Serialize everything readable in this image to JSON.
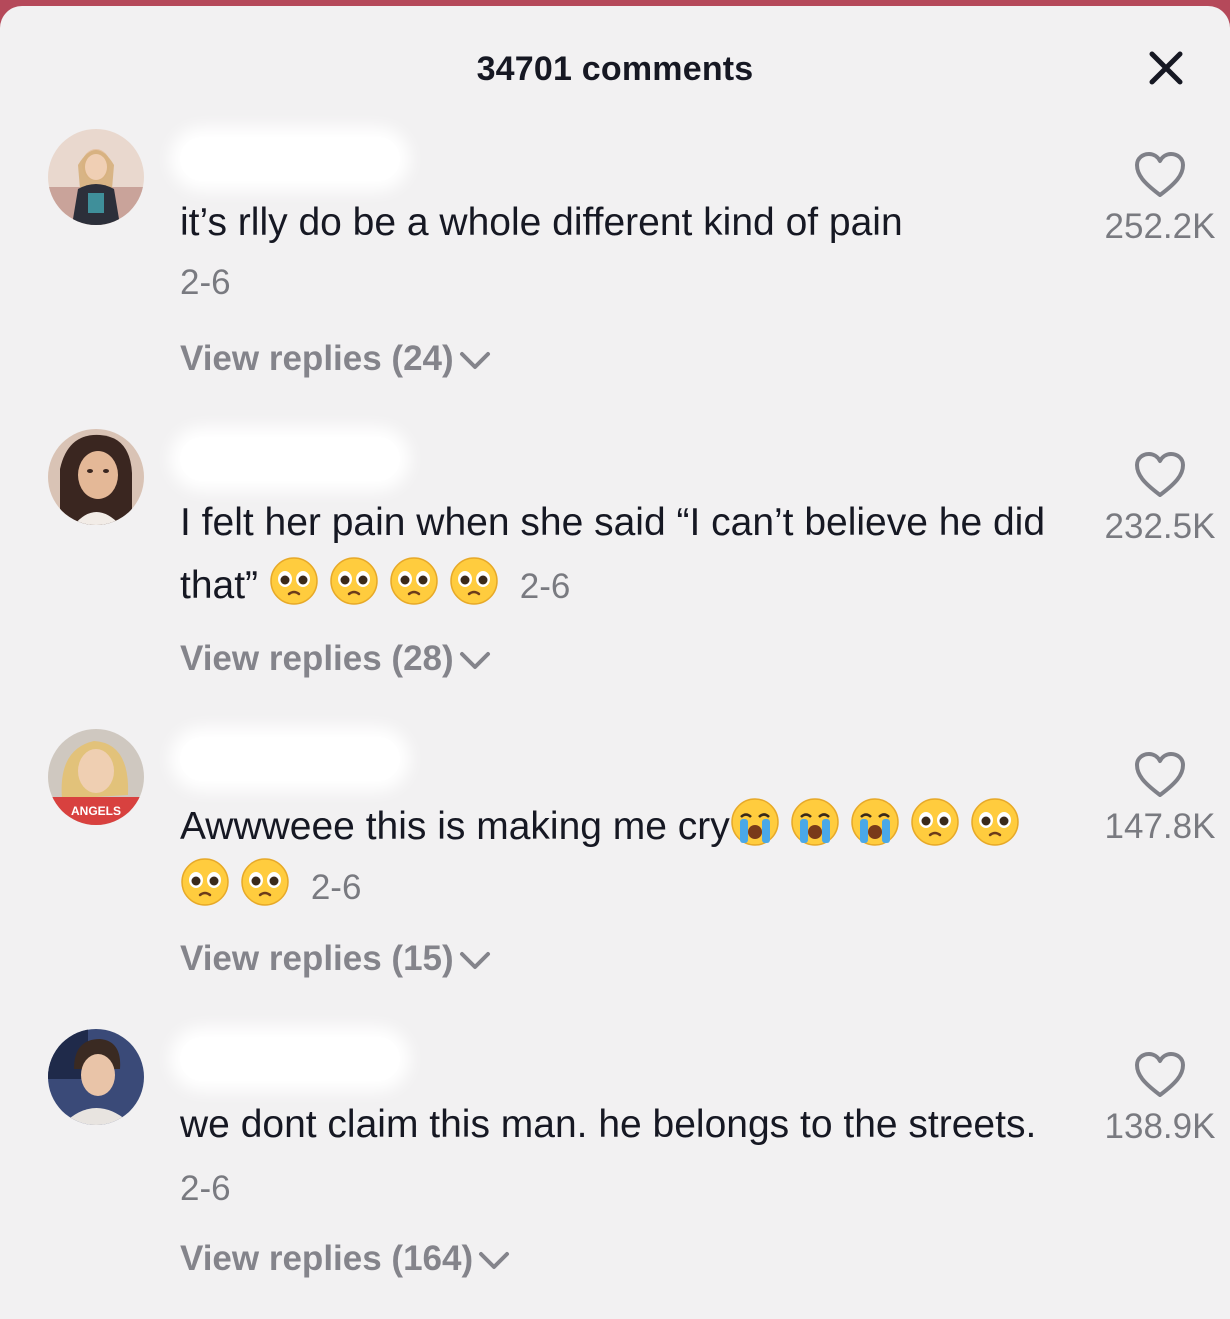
{
  "header": {
    "title": "34701 comments",
    "close_icon": "close-icon"
  },
  "comments": [
    {
      "text": "it’s rlly do be a whole different kind of pain",
      "emojis": [],
      "date": "2-6",
      "replies": "View replies (24)",
      "likes": "252.2K"
    },
    {
      "text": "I felt her pain when she said “I can’t believe he did that”",
      "emojis": [
        "pleading-face",
        "pleading-face",
        "pleading-face",
        "pleading-face"
      ],
      "date": "2-6",
      "replies": "View replies (28)",
      "likes": "232.5K"
    },
    {
      "text": "Awwweee this is making me cry",
      "emojis": [
        "loudly-crying-face",
        "loudly-crying-face",
        "loudly-crying-face",
        "pleading-face",
        "pleading-face",
        "pleading-face",
        "pleading-face"
      ],
      "date": "2-6",
      "replies": "View replies (15)",
      "likes": "147.8K"
    },
    {
      "text": "we dont claim this man. he belongs to the streets.",
      "emojis": [],
      "date": "2-6",
      "replies": "View replies (164)",
      "likes": "138.9K"
    }
  ],
  "avatar_text": "ANGELS",
  "colors": {
    "sheet_background": "#f2f1f2",
    "top_bar": "#b5495a",
    "primary_text": "#161823",
    "secondary_text": "#8a8b91"
  }
}
